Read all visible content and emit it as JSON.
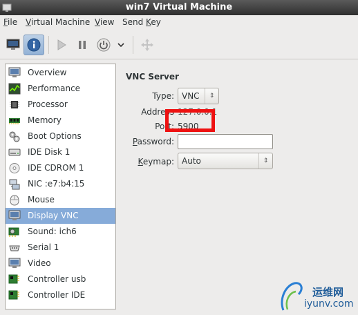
{
  "window": {
    "title": "win7 Virtual Machine"
  },
  "menu": [
    {
      "label": "File",
      "mnemonic": "F"
    },
    {
      "label": "Virtual Machine",
      "mnemonic": "V"
    },
    {
      "label": "View",
      "mnemonic": "V"
    },
    {
      "label": "Send Key",
      "mnemonic": "K"
    }
  ],
  "toolbar": {
    "buttons": [
      "console-icon",
      "details-info-icon",
      "run-play-icon",
      "pause-icon",
      "power-shutdown-icon",
      "dropdown-chevron-icon",
      "fullscreen-move-icon"
    ]
  },
  "sidebar": {
    "items": [
      {
        "label": "Overview",
        "icon": "monitor-icon"
      },
      {
        "label": "Performance",
        "icon": "performance-graph-icon"
      },
      {
        "label": "Processor",
        "icon": "cpu-chip-icon"
      },
      {
        "label": "Memory",
        "icon": "ram-module-icon"
      },
      {
        "label": "Boot Options",
        "icon": "gears-icon"
      },
      {
        "label": "IDE Disk 1",
        "icon": "hard-disk-icon"
      },
      {
        "label": "IDE CDROM 1",
        "icon": "cdrom-icon"
      },
      {
        "label": "NIC :e7:b4:15",
        "icon": "network-card-icon"
      },
      {
        "label": "Mouse",
        "icon": "mouse-icon"
      },
      {
        "label": "Display VNC",
        "icon": "display-monitor-icon",
        "selected": true
      },
      {
        "label": "Sound: ich6",
        "icon": "sound-card-icon"
      },
      {
        "label": "Serial 1",
        "icon": "serial-port-icon"
      },
      {
        "label": "Video",
        "icon": "video-monitor-icon"
      },
      {
        "label": "Controller usb",
        "icon": "controller-board-icon"
      },
      {
        "label": "Controller IDE",
        "icon": "controller-board-icon"
      }
    ]
  },
  "vnc": {
    "section_title": "VNC Server",
    "type_label": "Type:",
    "type_value": "VNC",
    "address_label": "Address",
    "address_value": "127.0.0.1",
    "port_label": "Port:",
    "port_value": "5900",
    "password_label": "Password:",
    "password_value": "",
    "keymap_label": "Keymap:",
    "keymap_value": "Auto"
  },
  "watermark": {
    "cn": "运维网",
    "url": "iyunv.com"
  },
  "colors": {
    "selection": "#86abd9",
    "highlight": "#ee1111",
    "titlebar": "#3c3c3c"
  }
}
